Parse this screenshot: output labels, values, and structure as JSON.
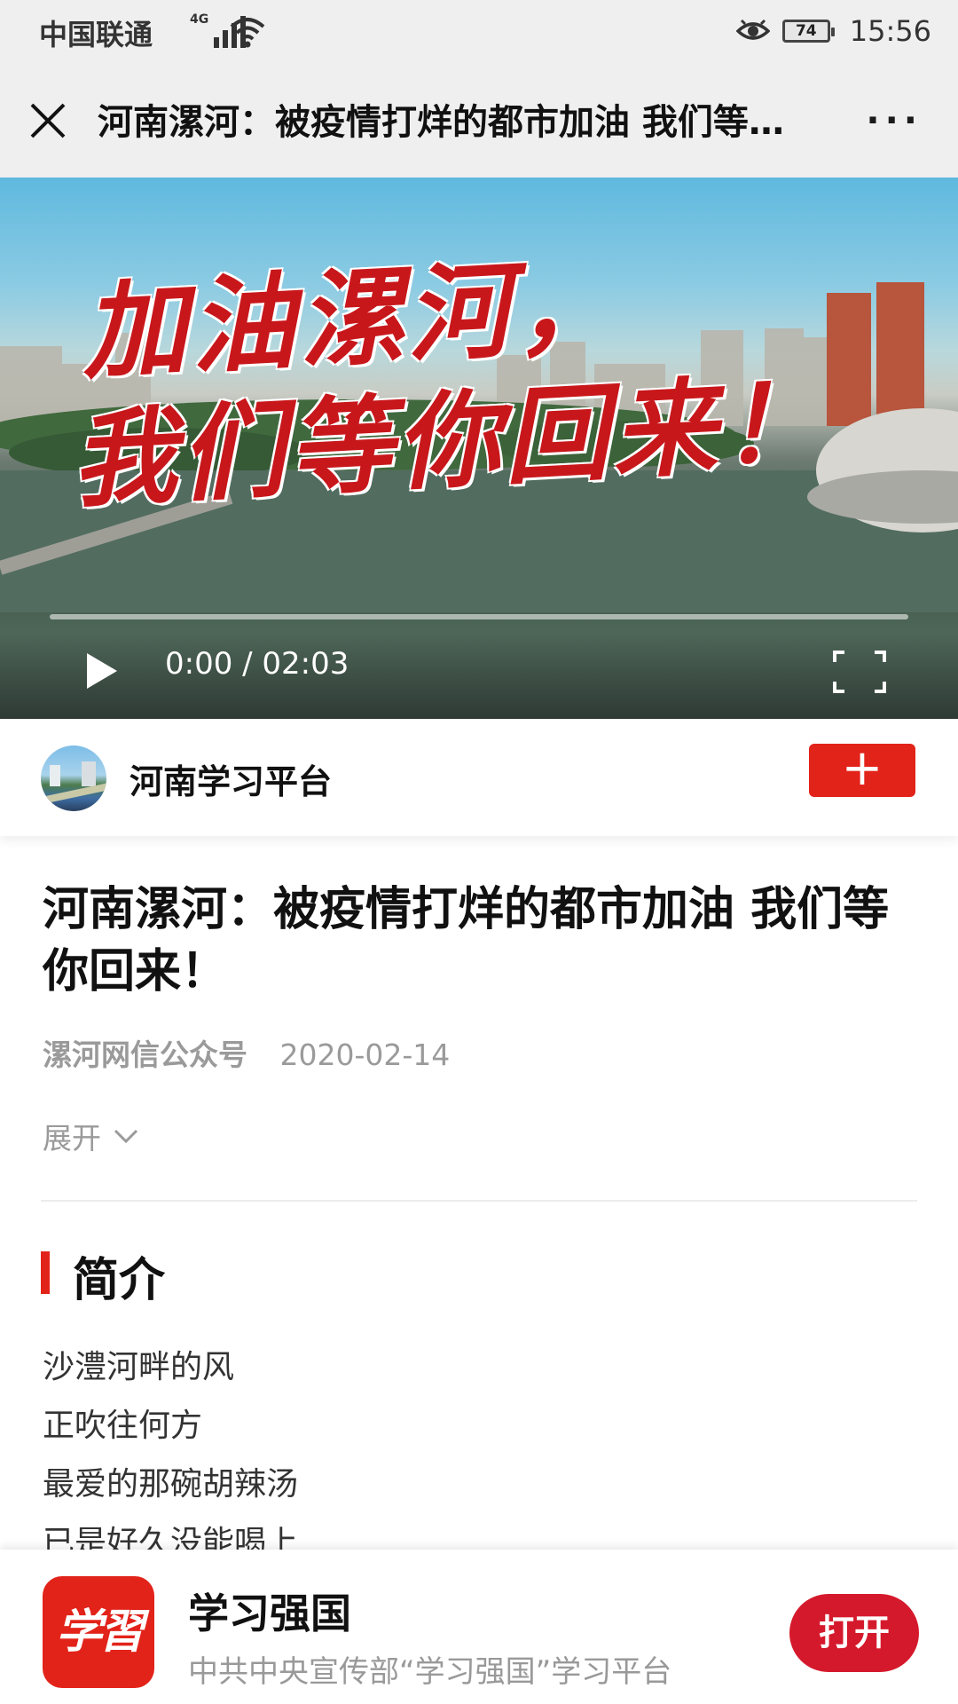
{
  "status_bar": {
    "carrier": "中国联通",
    "network": "4G",
    "battery": "74",
    "time": "15:56"
  },
  "title_bar": {
    "title": "河南漯河：被疫情打烊的都市加油 我们等你回来！",
    "more_label": "···"
  },
  "video": {
    "overlay_line1": "加油漯河，",
    "overlay_line2": "我们等你回来！",
    "time_display": "0:00 / 02:03",
    "progress": 0
  },
  "channel": {
    "name": "河南学习平台",
    "follow_label": "+"
  },
  "article": {
    "title": "河南漯河：被疫情打烊的都市加油 我们等你回来！",
    "source": "漯河网信公众号",
    "date": "2020-02-14",
    "expand_label": "展开"
  },
  "intro": {
    "heading": "简介",
    "lines": [
      "沙澧河畔的风",
      "正吹往何方",
      "最爱的那碗胡辣汤",
      "已是好久没能喝上"
    ]
  },
  "banner": {
    "logo_text": "学習",
    "app_name": "学习强国",
    "description": "中共中央宣传部“学习强国”学习平台",
    "open_label": "打开"
  },
  "colors": {
    "accent_red": "#e2231a",
    "open_button": "#d5192c",
    "meta_gray": "#9a9a9a"
  }
}
